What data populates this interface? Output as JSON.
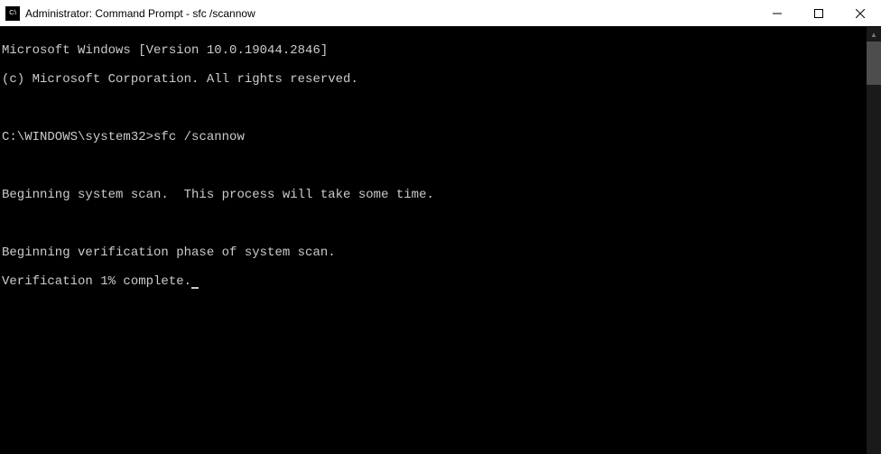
{
  "window": {
    "title": "Administrator: Command Prompt - sfc  /scannow",
    "icon_label": "C:\\"
  },
  "terminal": {
    "lines": [
      "Microsoft Windows [Version 10.0.19044.2846]",
      "(c) Microsoft Corporation. All rights reserved.",
      "",
      "C:\\WINDOWS\\system32>sfc /scannow",
      "",
      "Beginning system scan.  This process will take some time.",
      "",
      "Beginning verification phase of system scan.",
      "Verification 1% complete."
    ],
    "version_line": "Microsoft Windows [Version 10.0.19044.2846]",
    "copyright_line": "(c) Microsoft Corporation. All rights reserved.",
    "prompt": "C:\\WINDOWS\\system32>",
    "command": "sfc /scannow",
    "scan_begin": "Beginning system scan.  This process will take some time.",
    "verify_begin": "Beginning verification phase of system scan.",
    "verify_progress": "Verification 1% complete."
  },
  "scrollbar": {
    "thumb_top_px": "16",
    "thumb_height_px": "48"
  }
}
